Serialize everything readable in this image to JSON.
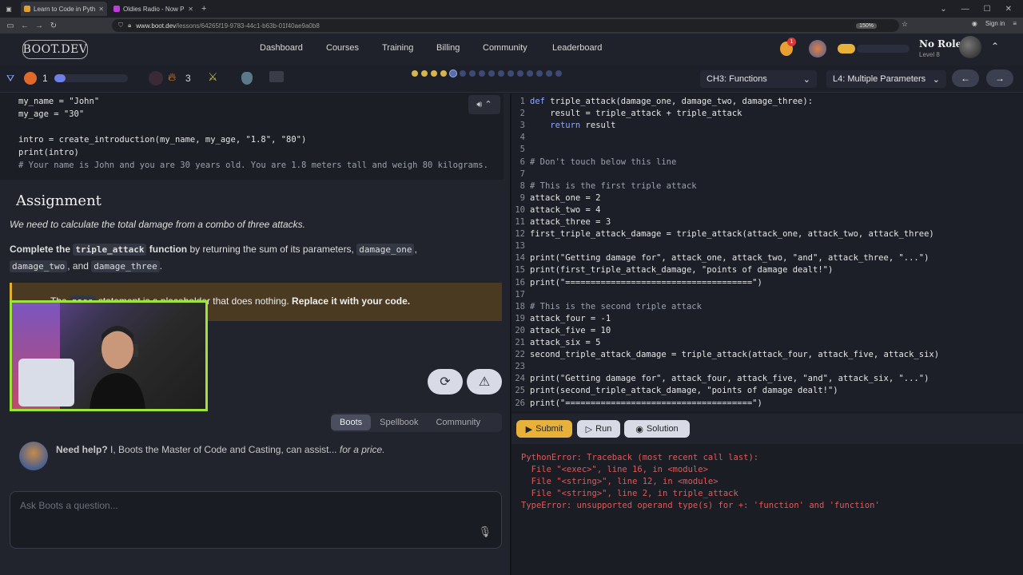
{
  "browser": {
    "tabs": [
      {
        "title": "Learn to Code in Python: M",
        "active": true,
        "favicon_color": "#e0a030"
      },
      {
        "title": "Oldies Radio - Now Play",
        "active": false,
        "favicon_color": "#c13adb"
      }
    ],
    "url_host": "www.boot.dev",
    "url_path": "/lessons/64265f19-9783-44c1-b63b-01f40ae9a0b8",
    "zoom": "150%",
    "signin": "Sign in"
  },
  "header": {
    "logo": "BOOT.DEV",
    "nav": [
      "Dashboard",
      "Courses",
      "Training",
      "Billing",
      "Community",
      "Leaderboard"
    ],
    "notif_count": "1",
    "user_name": "No Role",
    "user_level": "Level 8"
  },
  "subheader": {
    "gems": "1",
    "xp_fraction": 0.15,
    "fire": "3",
    "chapter": "CH3: Functions",
    "lesson": "L4: Multiple Parameters",
    "steps_done": 4,
    "steps_total": 16
  },
  "lesson": {
    "code_lines": [
      "my_name = \"John\"",
      "my_age = \"30\"",
      "",
      "intro = create_introduction(my_name, my_age, \"1.8\", \"80\")",
      "print(intro)"
    ],
    "code_comment": "# Your name is John and you are 30 years old. You are 1.8 meters tall and weigh 80 kilograms.",
    "assignment_title": "Assignment",
    "lead": "We need to calculate the total damage from a combo of three attacks.",
    "body_prefix": "Complete the",
    "fn_name": "triple_attack",
    "body_fn": "function",
    "body_mid": "by returning the sum of its parameters,",
    "param1": "damage_one",
    "param2": "damage_two",
    "and_text": ", and",
    "param3": "damage_three",
    "period": ".",
    "warn_text": "The",
    "warn_code": "pass",
    "warn_mid": "statement is a placeholder that does nothing.",
    "warn_bold": "Replace it with your code."
  },
  "boots": {
    "tabs": [
      "Boots",
      "Spellbook",
      "Community"
    ],
    "help_bold": "Need help?",
    "help_text": "I, Boots the Master of Code and Casting, can assist...",
    "help_italic": "for a price.",
    "ask_placeholder": "Ask Boots a question..."
  },
  "editor": {
    "lines": [
      {
        "n": "1",
        "t": "def triple_attack(damage_one, damage_two, damage_three):"
      },
      {
        "n": "2",
        "t": "    result = triple_attack + triple_attack"
      },
      {
        "n": "3",
        "t": "    return result"
      },
      {
        "n": "4",
        "t": ""
      },
      {
        "n": "5",
        "t": ""
      },
      {
        "n": "6",
        "t": "# Don't touch below this line"
      },
      {
        "n": "7",
        "t": ""
      },
      {
        "n": "8",
        "t": "# This is the first triple attack"
      },
      {
        "n": "9",
        "t": "attack_one = 2"
      },
      {
        "n": "10",
        "t": "attack_two = 4"
      },
      {
        "n": "11",
        "t": "attack_three = 3"
      },
      {
        "n": "12",
        "t": "first_triple_attack_damage = triple_attack(attack_one, attack_two, attack_three)"
      },
      {
        "n": "13",
        "t": ""
      },
      {
        "n": "14",
        "t": "print(\"Getting damage for\", attack_one, attack_two, \"and\", attack_three, \"...\")"
      },
      {
        "n": "15",
        "t": "print(first_triple_attack_damage, \"points of damage dealt!\")"
      },
      {
        "n": "16",
        "t": "print(\"=====================================\")"
      },
      {
        "n": "17",
        "t": ""
      },
      {
        "n": "18",
        "t": "# This is the second triple attack"
      },
      {
        "n": "19",
        "t": "attack_four = -1"
      },
      {
        "n": "20",
        "t": "attack_five = 10"
      },
      {
        "n": "21",
        "t": "attack_six = 5"
      },
      {
        "n": "22",
        "t": "second_triple_attack_damage = triple_attack(attack_four, attack_five, attack_six)"
      },
      {
        "n": "23",
        "t": ""
      },
      {
        "n": "24",
        "t": "print(\"Getting damage for\", attack_four, attack_five, \"and\", attack_six, \"...\")"
      },
      {
        "n": "25",
        "t": "print(second_triple_attack_damage, \"points of damage dealt!\")"
      },
      {
        "n": "26",
        "t": "print(\"=====================================\")"
      }
    ]
  },
  "actions": {
    "submit": "Submit",
    "run": "Run",
    "solution": "Solution"
  },
  "output": [
    "PythonError: Traceback (most recent call last):",
    "  File \"<exec>\", line 16, in <module>",
    "  File \"<string>\", line 12, in <module>",
    "  File \"<string>\", line 2, in triple_attack",
    "TypeError: unsupported operand type(s) for +: 'function' and 'function'"
  ],
  "colors": {
    "accent_gold": "#e8b23a",
    "error_red": "#e05a5a",
    "webcam_border": "#9de33c"
  }
}
